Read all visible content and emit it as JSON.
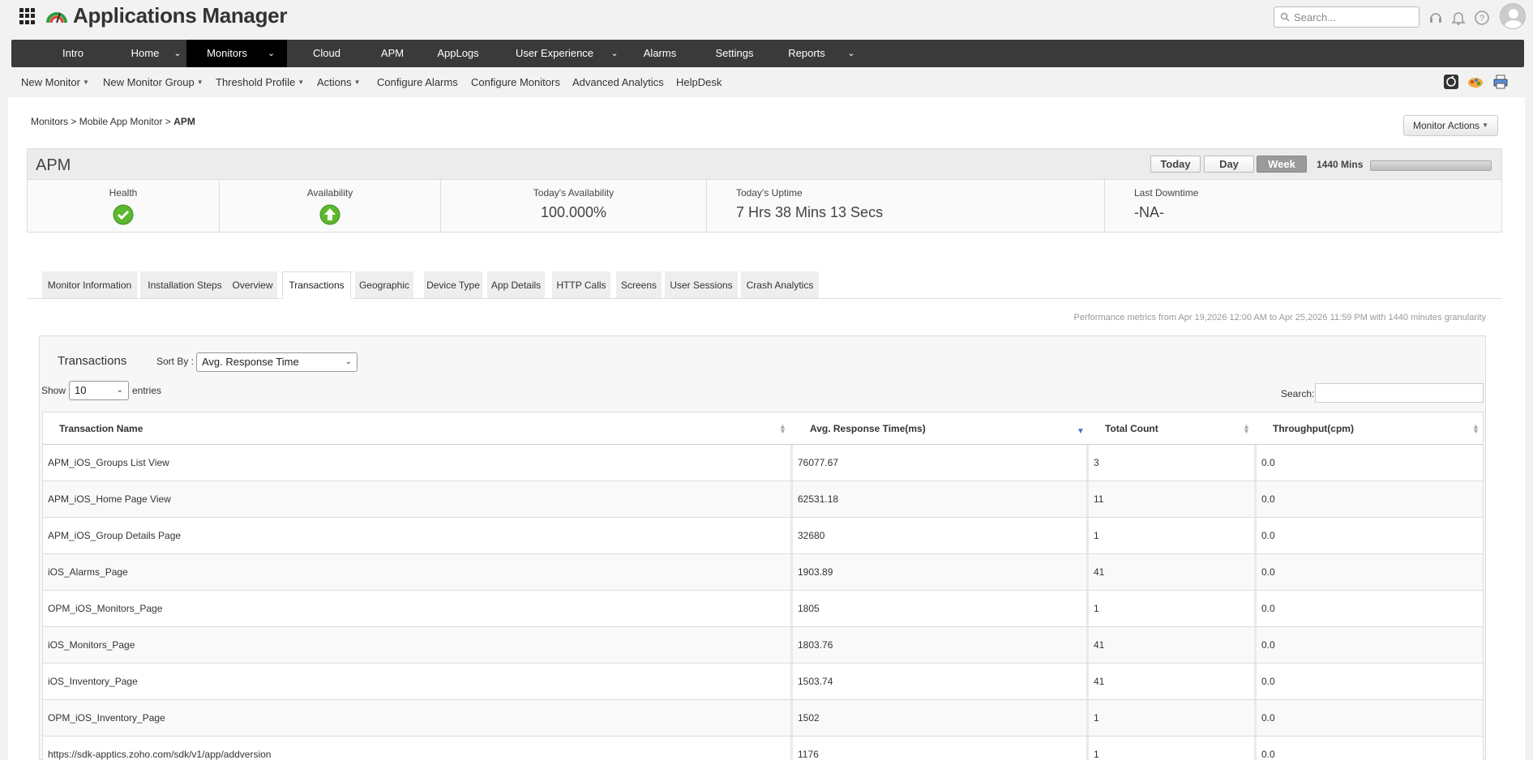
{
  "header": {
    "app_title": "Applications Manager",
    "search_placeholder": "Search..."
  },
  "mainnav": {
    "items": [
      {
        "label": "Intro"
      },
      {
        "label": "Home"
      },
      {
        "label": "Monitors"
      },
      {
        "label": "Cloud"
      },
      {
        "label": "APM"
      },
      {
        "label": "AppLogs"
      },
      {
        "label": "User Experience"
      },
      {
        "label": "Alarms"
      },
      {
        "label": "Settings"
      },
      {
        "label": "Reports"
      }
    ],
    "active": "Monitors"
  },
  "subnav": {
    "items": [
      {
        "label": "New Monitor"
      },
      {
        "label": "New Monitor Group"
      },
      {
        "label": "Threshold Profile"
      },
      {
        "label": "Actions"
      },
      {
        "label": "Configure Alarms"
      },
      {
        "label": "Configure Monitors"
      },
      {
        "label": "Advanced Analytics"
      },
      {
        "label": "HelpDesk"
      }
    ]
  },
  "breadcrumb": {
    "part1": "Monitors",
    "sep1": ">",
    "part2": "Mobile App Monitor",
    "sep2": ">",
    "current": "APM"
  },
  "monitor_actions_label": "Monitor Actions",
  "summary": {
    "title": "APM",
    "time_buttons": [
      "Today",
      "Day",
      "Week"
    ],
    "active_time": "Week",
    "mins_label": "1440 Mins",
    "health_label": "Health",
    "availability_label": "Availability",
    "todays_availability_label": "Today's Availability",
    "todays_availability_value": "100.000%",
    "todays_uptime_label": "Today's Uptime",
    "todays_uptime_value": "7 Hrs 38 Mins 13 Secs",
    "last_downtime_label": "Last Downtime",
    "last_downtime_value": "-NA-",
    "status_color": "#5cb82e"
  },
  "tabs": [
    {
      "label": "Monitor Information"
    },
    {
      "label": "Installation Steps"
    },
    {
      "label": "Overview"
    },
    {
      "label": "Transactions"
    },
    {
      "label": "Geographic"
    },
    {
      "label": "Device Type"
    },
    {
      "label": "App Details"
    },
    {
      "label": "HTTP Calls"
    },
    {
      "label": "Screens"
    },
    {
      "label": "User Sessions"
    },
    {
      "label": "Crash Analytics"
    }
  ],
  "active_tab": "Transactions",
  "perf_note": "Performance metrics from Apr 19,2026 12:00 AM to Apr 25,2026 11:59 PM with 1440 minutes granularity",
  "transactions": {
    "title": "Transactions",
    "sort_by_label": "Sort By :",
    "sort_by_value": "Avg. Response Time",
    "show_label": "Show",
    "show_value": "10",
    "entries_label": "entries",
    "search_label": "Search:",
    "columns": [
      "Transaction Name",
      "Avg. Response Time(ms)",
      "Total Count",
      "Throughput(cpm)"
    ],
    "rows": [
      {
        "name": "APM_iOS_Groups List View",
        "avg": "76077.67",
        "count": "3",
        "throughput": "0.0"
      },
      {
        "name": "APM_iOS_Home Page View",
        "avg": "62531.18",
        "count": "11",
        "throughput": "0.0"
      },
      {
        "name": "APM_iOS_Group Details Page",
        "avg": "32680",
        "count": "1",
        "throughput": "0.0"
      },
      {
        "name": "iOS_Alarms_Page",
        "avg": "1903.89",
        "count": "41",
        "throughput": "0.0"
      },
      {
        "name": "OPM_iOS_Monitors_Page",
        "avg": "1805",
        "count": "1",
        "throughput": "0.0"
      },
      {
        "name": "iOS_Monitors_Page",
        "avg": "1803.76",
        "count": "41",
        "throughput": "0.0"
      },
      {
        "name": "iOS_Inventory_Page",
        "avg": "1503.74",
        "count": "41",
        "throughput": "0.0"
      },
      {
        "name": "OPM_iOS_Inventory_Page",
        "avg": "1502",
        "count": "1",
        "throughput": "0.0"
      },
      {
        "name": "https://sdk-apptics.zoho.com/sdk/v1/app/addversion",
        "avg": "1176",
        "count": "1",
        "throughput": "0.0"
      }
    ]
  }
}
